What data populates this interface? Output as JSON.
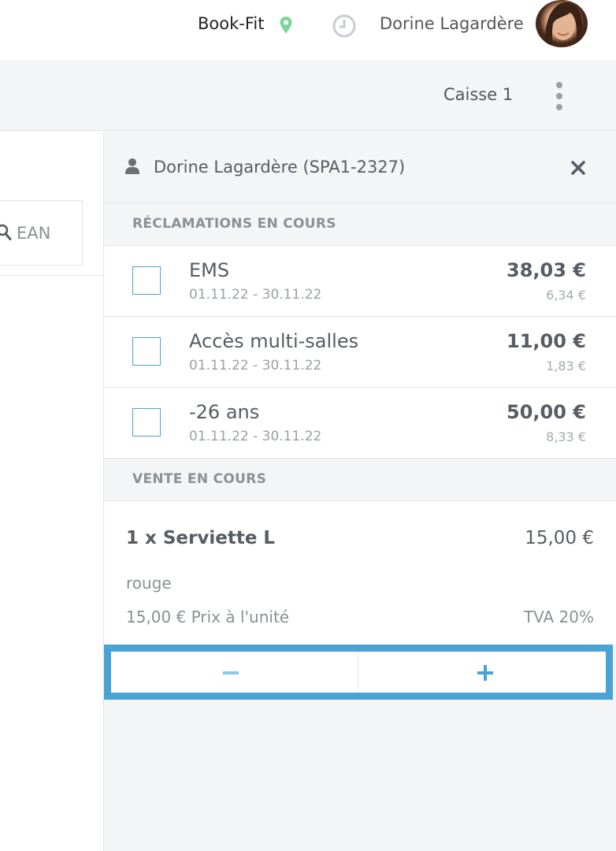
{
  "header": {
    "brand": "Book-Fit",
    "user_name": "Dorine Lagardère"
  },
  "toolbar": {
    "register": "Caisse 1"
  },
  "left": {
    "search_placeholder": "EAN"
  },
  "customer": {
    "label": "Dorine Lagardère (SPA1-2327)"
  },
  "claims": {
    "heading": "RÉCLAMATIONS EN COURS",
    "items": [
      {
        "name": "EMS",
        "dates": "01.11.22 - 30.11.22",
        "amount": "38,03 €",
        "tax": "6,34 €"
      },
      {
        "name": "Accès multi-salles",
        "dates": "01.11.22 - 30.11.22",
        "amount": "11,00 €",
        "tax": "1,83 €"
      },
      {
        "name": "-26 ans",
        "dates": "01.11.22 - 30.11.22",
        "amount": "50,00 €",
        "tax": "8,33 €"
      }
    ]
  },
  "sale": {
    "heading": "VENTE EN COURS",
    "item": {
      "title": "1 x Serviette L",
      "price": "15,00 €",
      "variant": "rouge",
      "unit_price": "15,00 € Prix à l'unité",
      "tax": "TVA 20%"
    }
  },
  "colors": {
    "accent": "#4aa3d5",
    "location_pin": "#7fd49a"
  }
}
